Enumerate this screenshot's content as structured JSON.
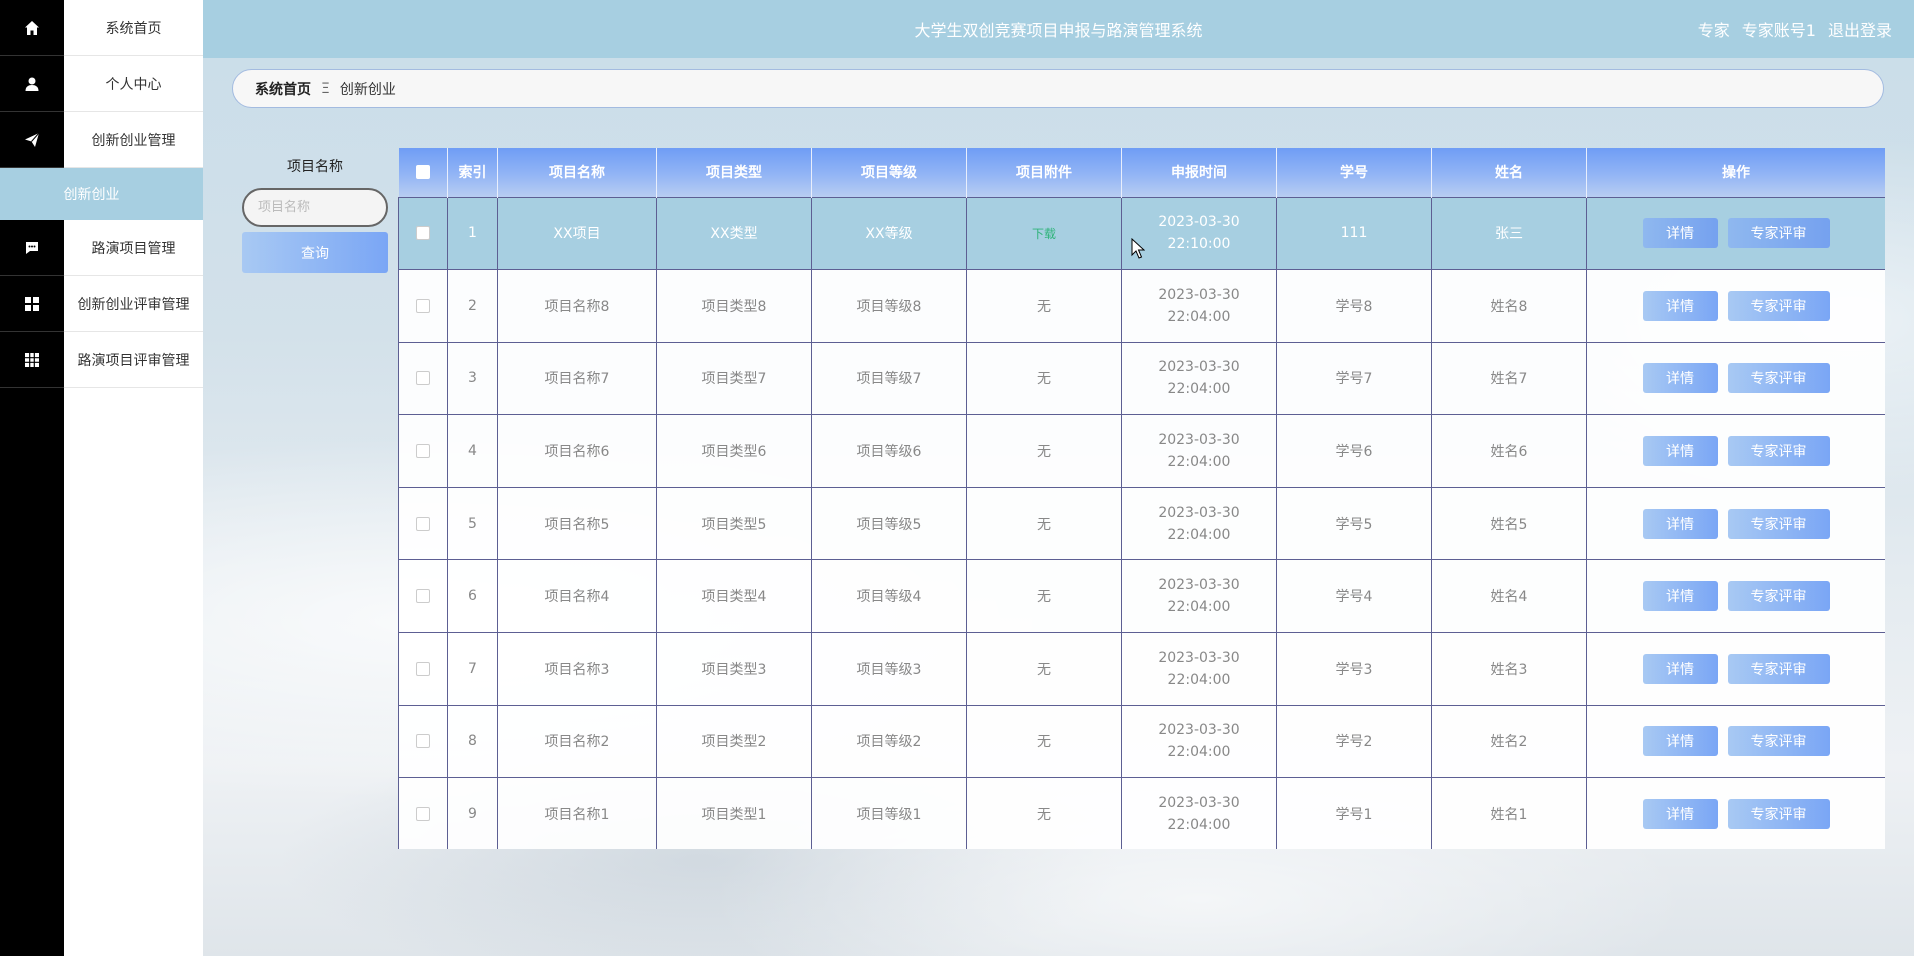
{
  "app": {
    "title": "大学生双创竞赛项目申报与路演管理系统",
    "user_role": "专家",
    "user_name": "专家账号1",
    "logout": "退出登录"
  },
  "sidebar": {
    "items": [
      {
        "label": "系统首页",
        "icon": "home-icon"
      },
      {
        "label": "个人中心",
        "icon": "user-icon"
      },
      {
        "label": "创新创业管理",
        "icon": "send-icon"
      },
      {
        "label": "路演项目管理",
        "icon": "chat-icon"
      },
      {
        "label": "创新创业评审管理",
        "icon": "grid-icon"
      },
      {
        "label": "路演项目评审管理",
        "icon": "apps-icon"
      }
    ],
    "active_sub": "创新创业"
  },
  "breadcrumb": {
    "home": "系统首页",
    "separator": "Ξ",
    "current": "创新创业"
  },
  "search": {
    "label": "项目名称",
    "placeholder": "项目名称",
    "value": "",
    "button": "查询"
  },
  "table": {
    "headers": [
      "索引",
      "项目名称",
      "项目类型",
      "项目等级",
      "项目附件",
      "申报时间",
      "学号",
      "姓名",
      "操作"
    ],
    "detail_label": "详情",
    "review_label": "专家评审",
    "rows": [
      {
        "index": "1",
        "name": "XX项目",
        "type": "XX类型",
        "level": "XX等级",
        "attach": "下载",
        "time": "2023-03-30 22:10:00",
        "sid": "111",
        "sname": "张三"
      },
      {
        "index": "2",
        "name": "项目名称8",
        "type": "项目类型8",
        "level": "项目等级8",
        "attach": "无",
        "time": "2023-03-30 22:04:00",
        "sid": "学号8",
        "sname": "姓名8"
      },
      {
        "index": "3",
        "name": "项目名称7",
        "type": "项目类型7",
        "level": "项目等级7",
        "attach": "无",
        "time": "2023-03-30 22:04:00",
        "sid": "学号7",
        "sname": "姓名7"
      },
      {
        "index": "4",
        "name": "项目名称6",
        "type": "项目类型6",
        "level": "项目等级6",
        "attach": "无",
        "time": "2023-03-30 22:04:00",
        "sid": "学号6",
        "sname": "姓名6"
      },
      {
        "index": "5",
        "name": "项目名称5",
        "type": "项目类型5",
        "level": "项目等级5",
        "attach": "无",
        "time": "2023-03-30 22:04:00",
        "sid": "学号5",
        "sname": "姓名5"
      },
      {
        "index": "6",
        "name": "项目名称4",
        "type": "项目类型4",
        "level": "项目等级4",
        "attach": "无",
        "time": "2023-03-30 22:04:00",
        "sid": "学号4",
        "sname": "姓名4"
      },
      {
        "index": "7",
        "name": "项目名称3",
        "type": "项目类型3",
        "level": "项目等级3",
        "attach": "无",
        "time": "2023-03-30 22:04:00",
        "sid": "学号3",
        "sname": "姓名3"
      },
      {
        "index": "8",
        "name": "项目名称2",
        "type": "项目类型2",
        "level": "项目等级2",
        "attach": "无",
        "time": "2023-03-30 22:04:00",
        "sid": "学号2",
        "sname": "姓名2"
      },
      {
        "index": "9",
        "name": "项目名称1",
        "type": "项目类型1",
        "level": "项目等级1",
        "attach": "无",
        "time": "2023-03-30 22:04:00",
        "sid": "学号1",
        "sname": "姓名1"
      }
    ]
  },
  "colors": {
    "header_bar": "#a7cfe1",
    "accent_blue": "#7aa6f5",
    "download_green": "#2fb37a"
  }
}
